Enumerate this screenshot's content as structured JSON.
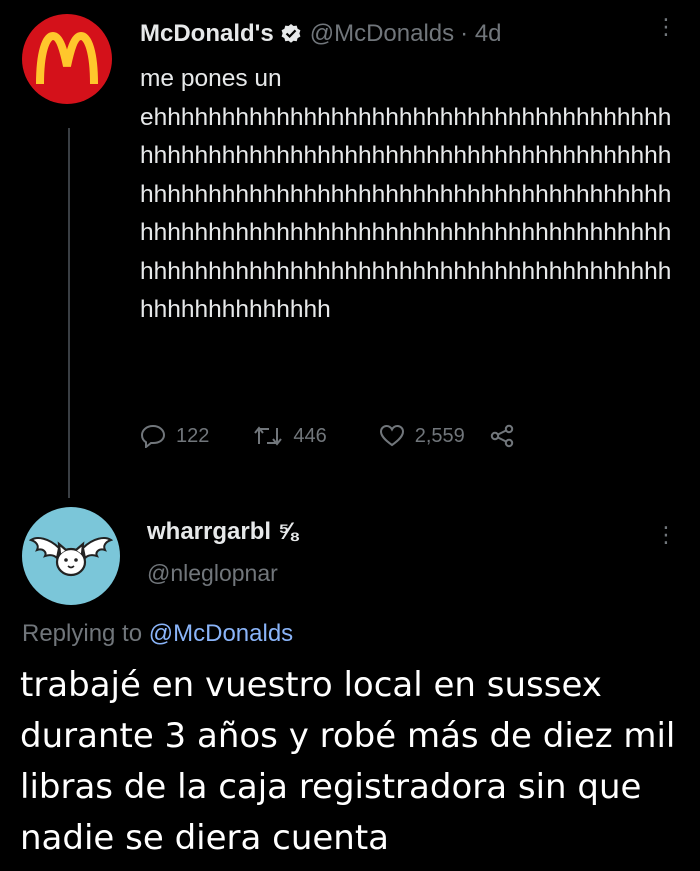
{
  "tweet1": {
    "author_name": "McDonald's",
    "handle": "@McDonalds",
    "time": "· 4d",
    "text_line1": "me pones un",
    "text_long": "ehhhhhhhhhhhhhhhhhhhhhhhhhhhhhhhhhhhhhhhhhhhhhhhhhhhhhhhhhhhhhhhhhhhhhhhhhhhhhhhhhhhhhhhhhhhhhhhhhhhhhhhhhhhhhhhhhhhhhhhhhhhhhhhhhhhhhhhhhhhhhhhhhhhhhhhhhhhhhhhhhhhhhhhhhhhhhhhhhhhhhhhhhhhhhhhhhhhhhhhhhhhhhhhh",
    "replies": "122",
    "retweets": "446",
    "likes": "2,559",
    "brand_color": "#d4111a"
  },
  "tweet2": {
    "author_name": "wharrgarbl ⅝",
    "handle": "@nleglopnar",
    "replying_prefix": "Replying to",
    "replying_mention": "@McDonalds",
    "text": "trabajé en vuestro local en sussex durante 3 años y robé más de diez mil libras de la caja registradora sin que nadie se diera cuenta",
    "avatar_color": "#7bc6d9"
  },
  "icons": [
    "mcdonalds-logo-icon",
    "verified-badge-icon",
    "more-icon",
    "reply-icon",
    "retweet-icon",
    "like-icon",
    "share-icon",
    "winged-cat-avatar-icon"
  ]
}
